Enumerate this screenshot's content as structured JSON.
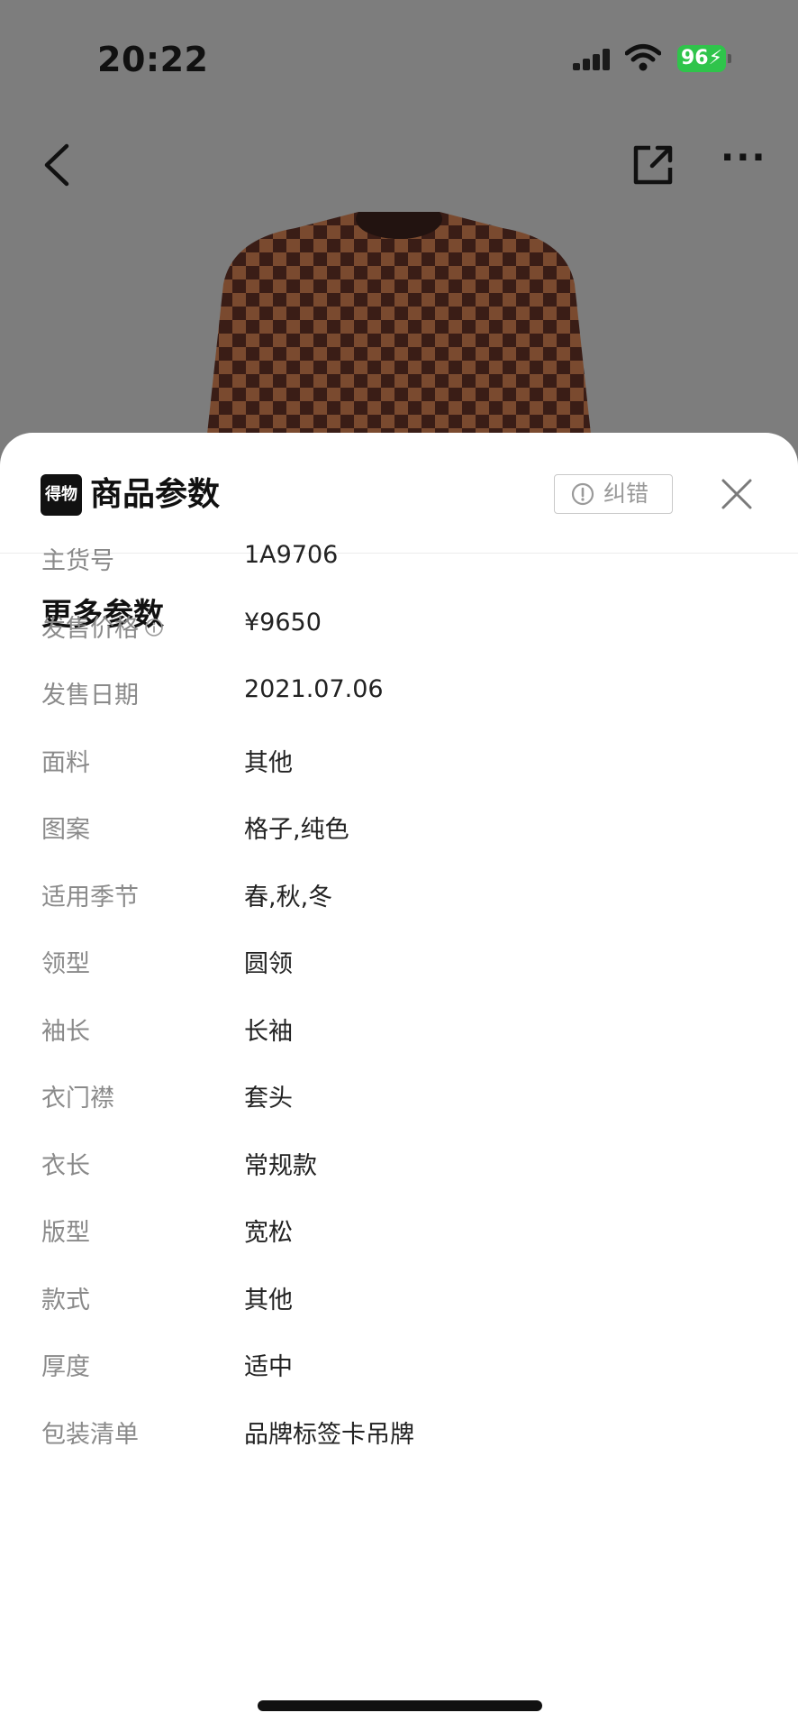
{
  "status_bar": {
    "time": "20:22",
    "battery": "96"
  },
  "sheet": {
    "logo_text": "得物",
    "title": "商品参数",
    "report_button": "纠错",
    "section_title": "更多参数",
    "params": [
      {
        "label": "主货号",
        "value": "1A9706"
      },
      {
        "label": "发售价格",
        "value": "¥9650"
      },
      {
        "label": "发售日期",
        "value": "2021.07.06"
      },
      {
        "label": "面料",
        "value": "其他"
      },
      {
        "label": "图案",
        "value": "格子,纯色"
      },
      {
        "label": "适用季节",
        "value": "春,秋,冬"
      },
      {
        "label": "领型",
        "value": "圆领"
      },
      {
        "label": "袖长",
        "value": "长袖"
      },
      {
        "label": "衣门襟",
        "value": "套头"
      },
      {
        "label": "衣长",
        "value": "常规款"
      },
      {
        "label": "版型",
        "value": "宽松"
      },
      {
        "label": "款式",
        "value": "其他"
      },
      {
        "label": "厚度",
        "value": "适中"
      },
      {
        "label": "包装清单",
        "value": "品牌标签卡吊牌"
      }
    ]
  },
  "icons": {
    "back": "back-chevron-icon",
    "share": "share-icon",
    "more": "more-icon",
    "close": "close-icon",
    "alert": "alert-circle-icon",
    "info": "info-icon"
  },
  "colors": {
    "battery": "#2fc44b",
    "backdrop": "#7d7d7d",
    "label": "#8a8a8a",
    "value": "#222222"
  }
}
